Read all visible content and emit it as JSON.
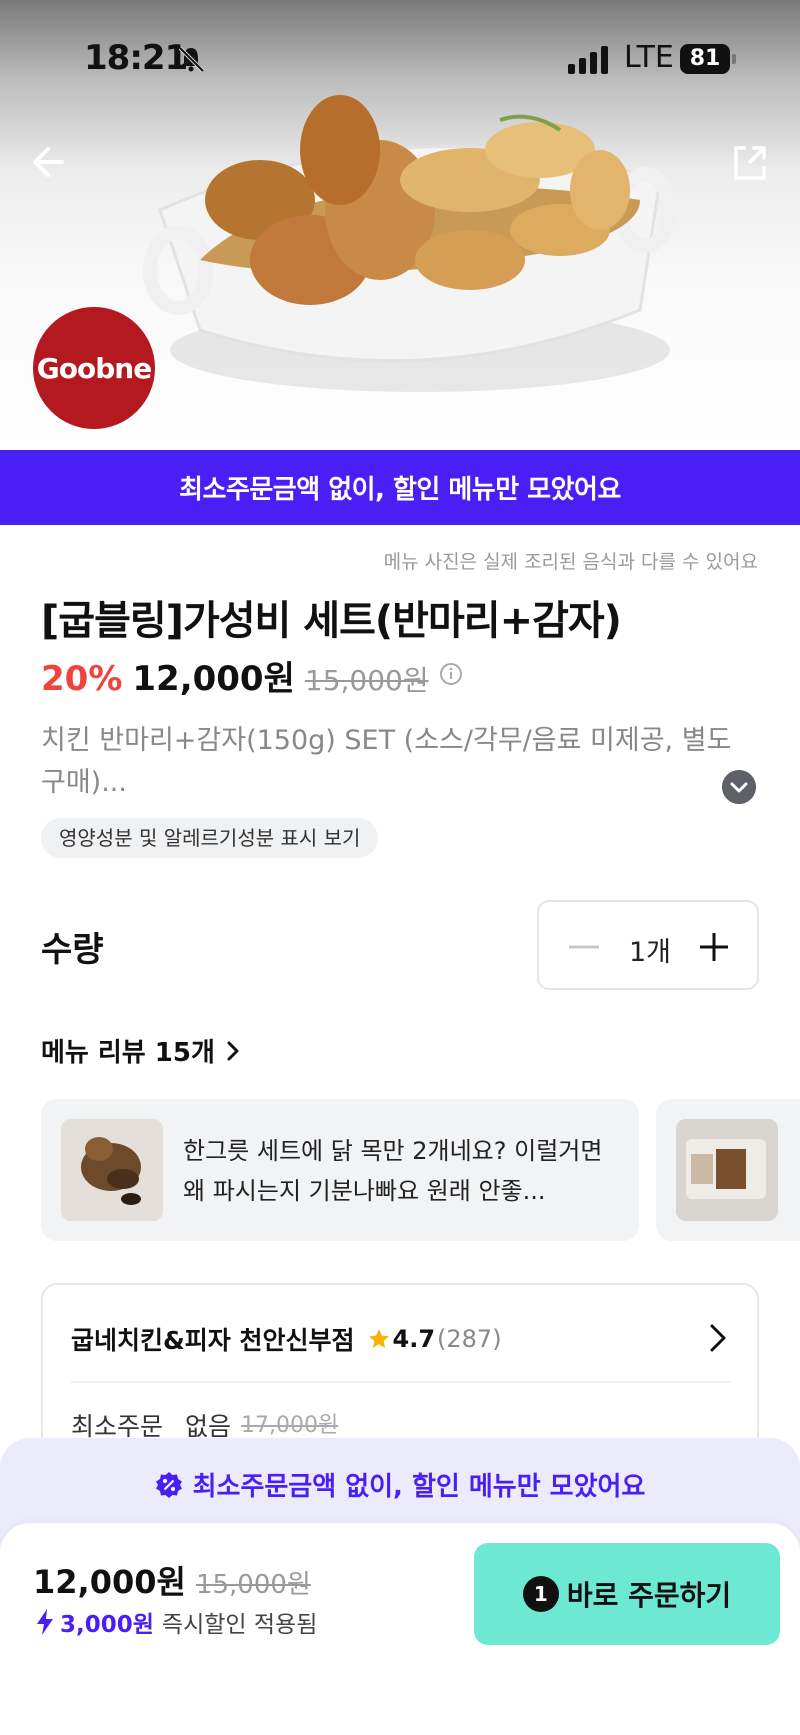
{
  "status_bar": {
    "time": "18:21",
    "network": "LTE",
    "battery": "81"
  },
  "header": {
    "back_icon": "arrow-left-icon",
    "share_icon": "share-icon",
    "brand_logo_text": "Goobne"
  },
  "promo_banner": {
    "text": "최소주문금액 없이, 할인 메뉴만 모았어요"
  },
  "menu": {
    "photo_note": "메뉴 사진은 실제 조리된 음식과 다를 수 있어요",
    "title": "[굽블링]가성비 세트(반마리+감자)",
    "discount": "20%",
    "price": "12,000원",
    "original_price": "15,000원",
    "description": "치킨 반마리+감자(150g) SET (소스/각무/음료 미제공, 별도 구매)...",
    "nutrition_chip": "영양성분 및 알레르기성분 표시 보기"
  },
  "quantity": {
    "label": "수량",
    "value": "1개"
  },
  "reviews": {
    "header": "메뉴 리뷰 15개",
    "items": [
      {
        "text": "한그릇 세트에 닭 목만 2개네요? 이럴거면 왜 파시는지 기분나빠요 원래 안좋..."
      }
    ]
  },
  "store": {
    "name": "굽네치킨&피자 천안신부점",
    "rating": "4.7",
    "rating_count": "(287)",
    "min_order_label": "최소주문",
    "min_order_value": "없음",
    "min_order_original": "17,000원"
  },
  "bottom_bar": {
    "banner_text": "최소주문금액 없이, 할인 메뉴만 모았어요",
    "total_price": "12,000원",
    "total_original": "15,000원",
    "saving_amount": "3,000원",
    "saving_label": "즉시할인 적용됨",
    "order_count": "1",
    "order_button": "바로 주문하기"
  },
  "colors": {
    "accent": "#4a1ff5",
    "discount": "#f1423c",
    "order_button": "#6de8d3",
    "brand": "#b3191f"
  }
}
